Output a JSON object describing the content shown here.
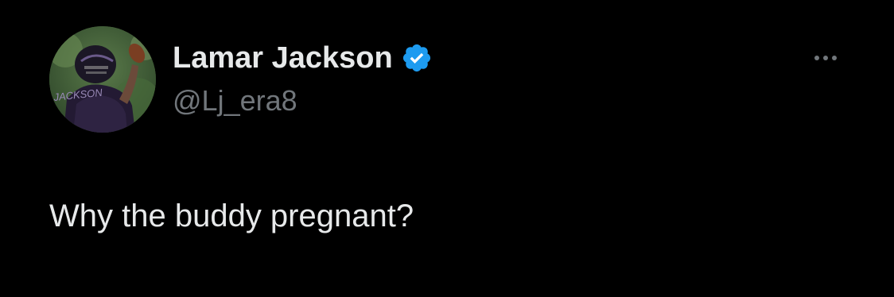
{
  "user": {
    "display_name": "Lamar Jackson",
    "handle": "@Lj_era8",
    "verified": true,
    "avatar_jersey_text": "JACKSON"
  },
  "tweet": {
    "text": "Why the buddy pregnant?"
  },
  "icons": {
    "verified": "verified-badge-icon",
    "more": "more-options-icon"
  },
  "colors": {
    "background": "#000000",
    "primary_text": "#e7e9ea",
    "secondary_text": "#71767b",
    "verified_blue": "#1d9bf0"
  }
}
